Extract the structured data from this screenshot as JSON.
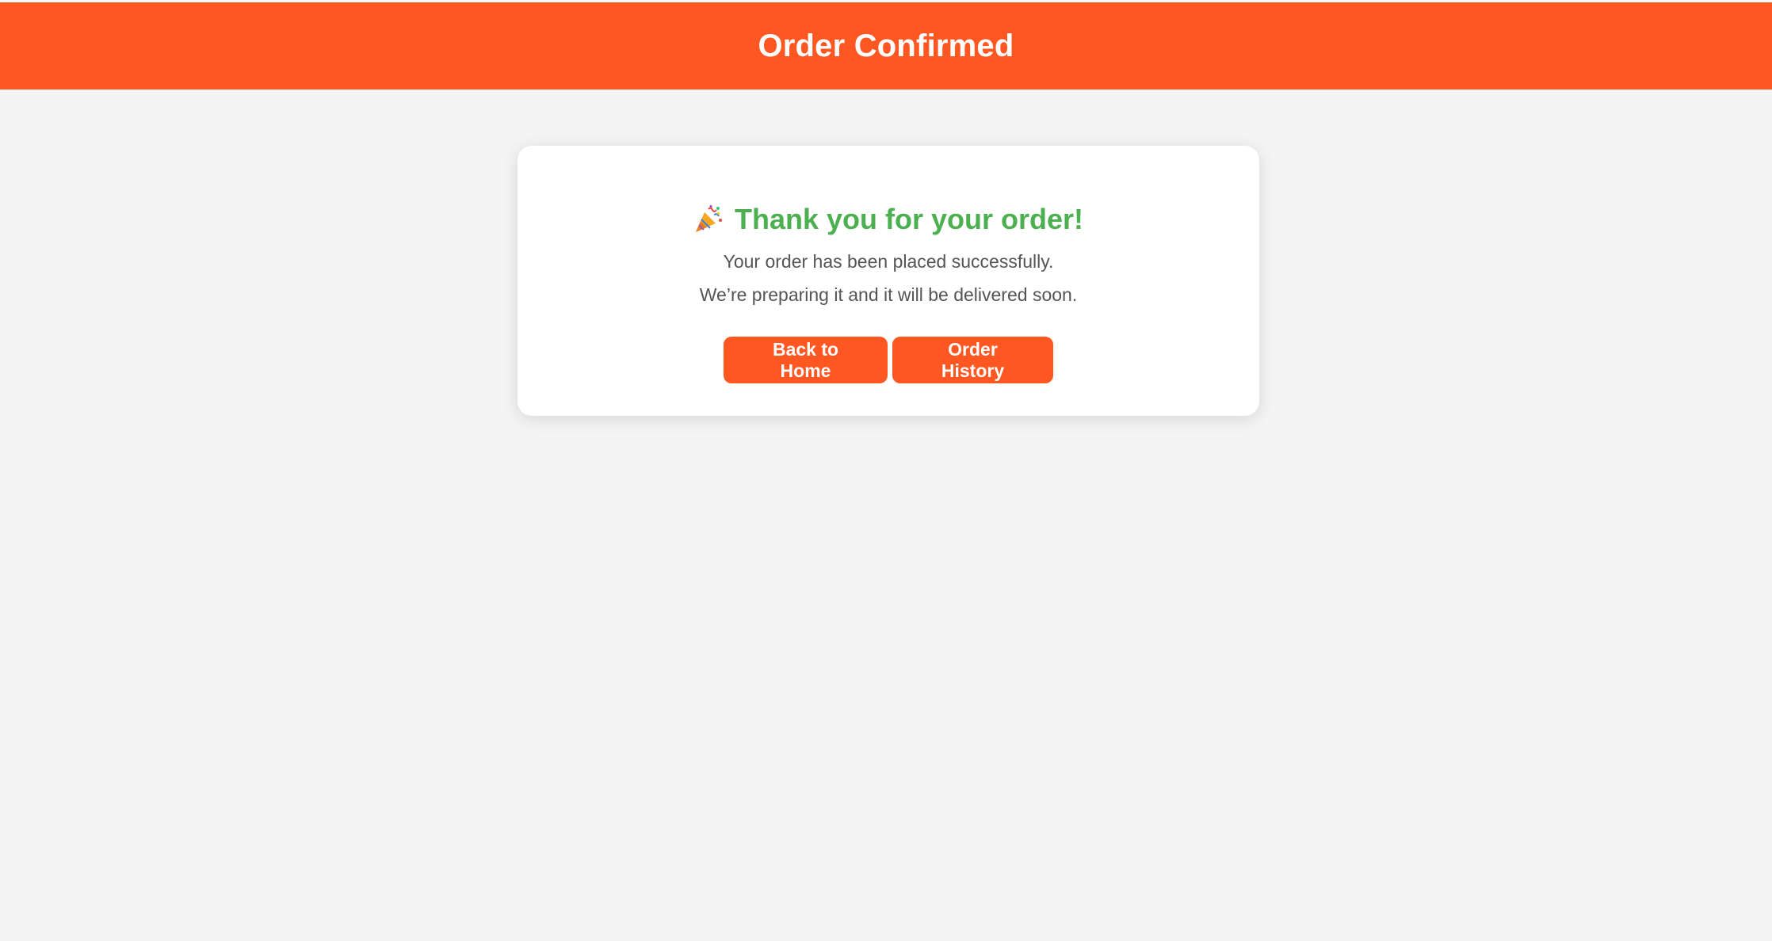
{
  "header": {
    "title": "Order Confirmed",
    "background_color": "#ff5722"
  },
  "confirmation": {
    "icon": "party-popper-icon",
    "heading": "Thank you for your order!",
    "heading_color": "#4caf50",
    "line1": "Your order has been placed successfully.",
    "line2": "We’re preparing it and it will be delivered soon."
  },
  "actions": {
    "home_label": "Back to Home",
    "history_label": "Order History",
    "button_color": "#ff5722"
  }
}
